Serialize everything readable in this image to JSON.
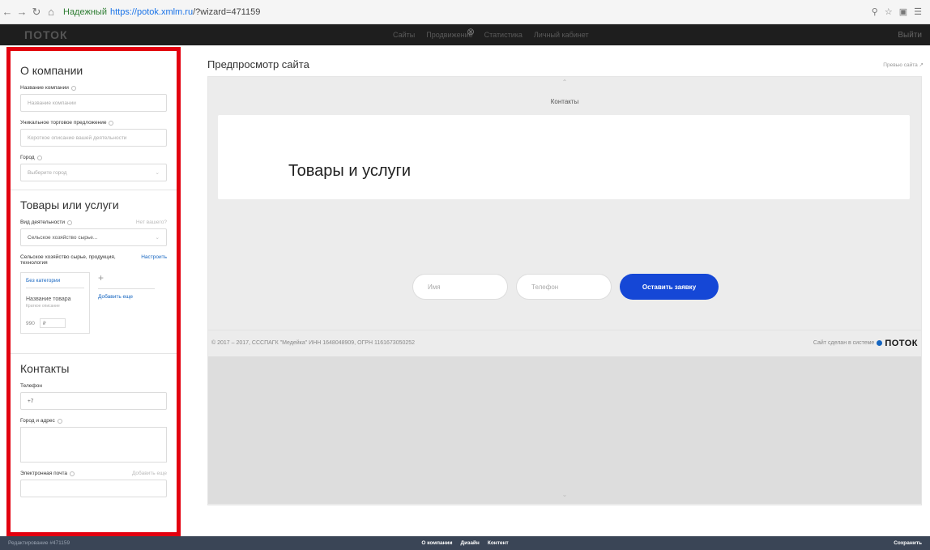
{
  "browser": {
    "secure_label": "Надежный",
    "url_host": "https://potok.xmlm.ru",
    "url_path": "/?wizard=471159"
  },
  "app": {
    "logo": "ПОТОК",
    "nav": [
      "Сайты",
      "Продвижение",
      "Статистика",
      "Личный кабинет"
    ],
    "exit": "Выйти"
  },
  "company": {
    "title": "О компании",
    "name_label": "Название компании",
    "name_placeholder": "Название компании",
    "usp_label": "Уникальное торговое предложение",
    "usp_placeholder": "Короткое описание вашей деятельности",
    "city_label": "Город",
    "city_placeholder": "Выберите город"
  },
  "goods": {
    "title": "Товары или услуги",
    "activity_label": "Вид деятельности",
    "activity_hint": "Нет вашего?",
    "activity_value": "Сельское хозяйство сырье...",
    "category_text": "Сельское хозяйство сырье, продукция, технология",
    "configure_link": "Настроить",
    "no_category": "Без категории",
    "product_name": "Название товара",
    "product_sub": "Краткое описание",
    "price": "990",
    "currency": "₽",
    "add_more": "Добавить еще"
  },
  "contacts": {
    "title": "Контакты",
    "phone_label": "Телефон",
    "phone_value": "+7",
    "address_label": "Город и адрес",
    "email_label": "Электронная почта",
    "email_hint": "Добавить еще"
  },
  "preview": {
    "title": "Предпросмотр сайта",
    "open_site": "Превью сайта ↗",
    "section_label": "Контакты",
    "goods_heading": "Товары и услуги",
    "name_placeholder": "Имя",
    "phone_placeholder": "Телефон",
    "submit_label": "Оставить заявку",
    "footer_copy": "© 2017 – 2017, СССПАГК \"Медейка\" ИНН 1648048909, ОГРН 1161673050252",
    "made_text": "Сайт сделан в системе",
    "made_logo": "ПОТОК"
  },
  "bottom": {
    "editing": "Редактирование #471159",
    "tabs": [
      "О компании",
      "Дизайн",
      "Контент"
    ],
    "save": "Сохранить"
  }
}
